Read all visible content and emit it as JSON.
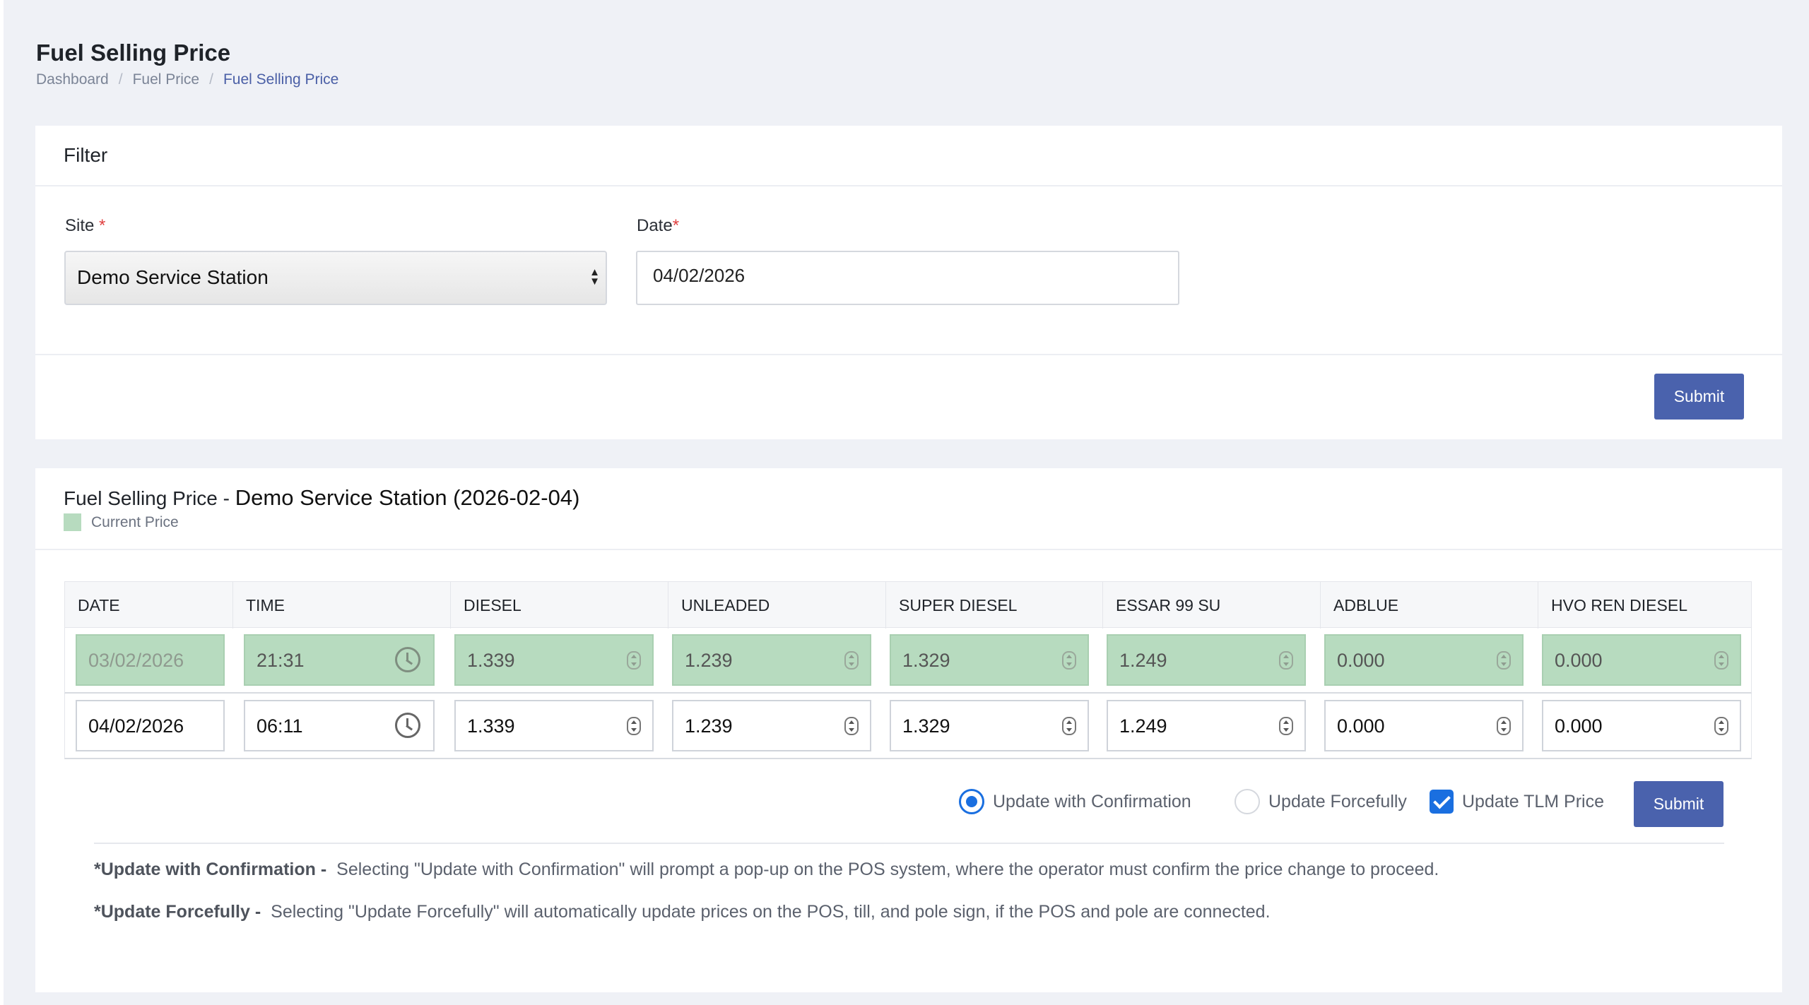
{
  "page": {
    "title": "Fuel Selling Price",
    "breadcrumb": [
      "Dashboard",
      "Fuel Price",
      "Fuel Selling Price"
    ]
  },
  "filter": {
    "header": "Filter",
    "site_label": "Site",
    "site_value": "Demo Service Station",
    "date_label": "Date",
    "date_value": "04/02/2026",
    "submit_label": "Submit",
    "required_mark": "*"
  },
  "price": {
    "title_prefix": "Fuel Selling Price -",
    "title_site": "Demo Service Station (2026-02-04)",
    "legend_label": "Current Price",
    "legend_color": "#b7dbbf",
    "columns": [
      "DATE",
      "TIME",
      "DIESEL",
      "UNLEADED",
      "SUPER DIESEL",
      "ESSAR 99 SU",
      "ADBLUE",
      "HVO REN DIESEL"
    ],
    "current_row": {
      "date": "03/02/2026",
      "time": "21:31",
      "prices": [
        "1.339",
        "1.239",
        "1.329",
        "1.249",
        "0.000",
        "0.000"
      ]
    },
    "new_row": {
      "date": "04/02/2026",
      "time": "06:11",
      "prices": [
        "1.339",
        "1.239",
        "1.329",
        "1.249",
        "0.000",
        "0.000"
      ]
    },
    "options": {
      "update_confirmation": "Update with Confirmation",
      "update_forcefully": "Update Forcefully",
      "update_tlm": "Update TLM Price",
      "submit_label": "Submit"
    },
    "notes": {
      "confirm_title": "*Update with Confirmation -",
      "confirm_text": "Selecting \"Update with Confirmation\" will prompt a pop-up on the POS system, where the operator must confirm the price change to proceed.",
      "force_title": "*Update Forcefully -",
      "force_text": "Selecting \"Update Forcefully\" will automatically update prices on the POS, till, and pole sign, if the POS and pole are connected."
    }
  },
  "colors": {
    "accent": "#4a62ad",
    "radio_check": "#1a6fe0",
    "current_price_bg": "#b7dbbf"
  }
}
